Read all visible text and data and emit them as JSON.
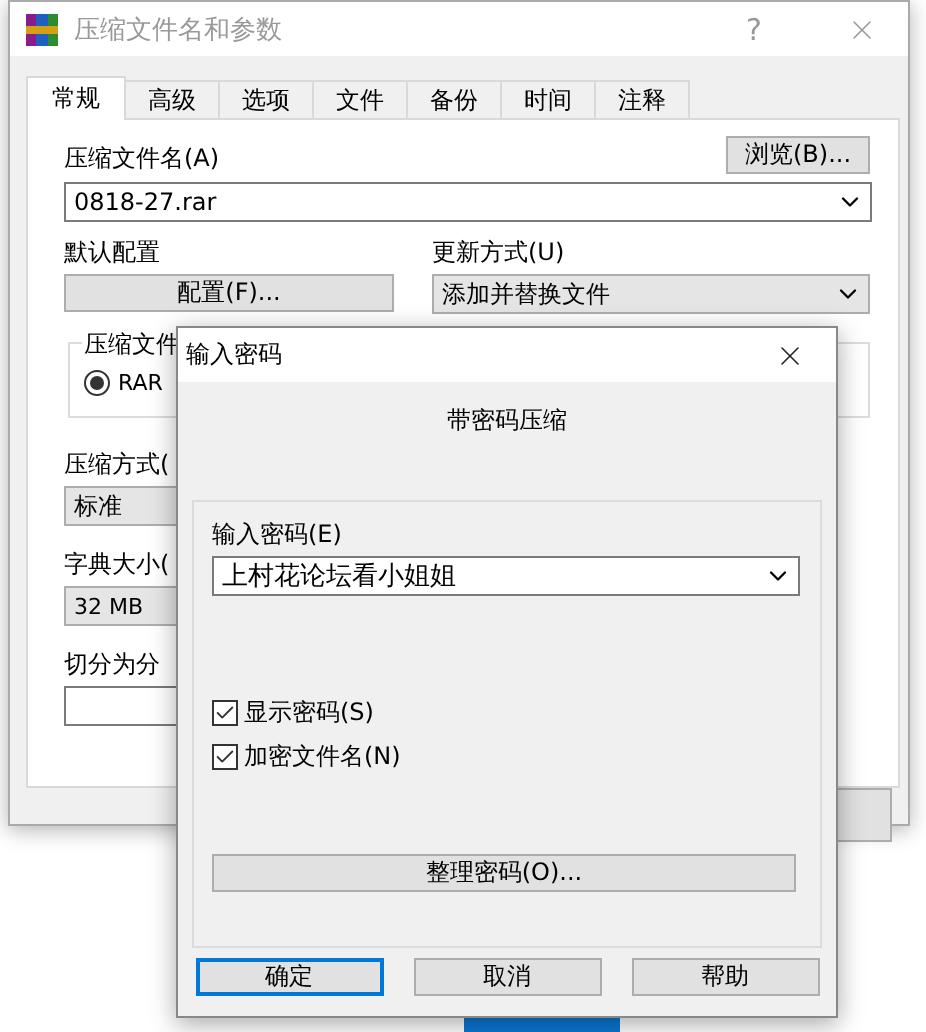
{
  "main_window": {
    "title": "压缩文件名和参数",
    "help": "?",
    "tabs": [
      {
        "label": "常规",
        "selected": true
      },
      {
        "label": "高级",
        "selected": false
      },
      {
        "label": "选项",
        "selected": false
      },
      {
        "label": "文件",
        "selected": false
      },
      {
        "label": "备份",
        "selected": false
      },
      {
        "label": "时间",
        "selected": false
      },
      {
        "label": "注释",
        "selected": false
      }
    ],
    "archive_name_label": "压缩文件名(A)",
    "browse_button": "浏览(B)...",
    "archive_name": "0818-27.rar",
    "profile_label": "默认配置",
    "profile_button": "配置(F)...",
    "update_label": "更新方式(U)",
    "update_mode": "添加并替换文件",
    "format_label": "压缩文件",
    "formats": [
      {
        "label": "RAR",
        "selected": true
      }
    ],
    "method_label": "压缩方式(",
    "method": "标准",
    "dict_label": "字典大小(",
    "dict": "32 MB",
    "split_label": "切分为分"
  },
  "password_dialog": {
    "title": "输入密码",
    "heading": "带密码压缩",
    "password_label": "输入密码(E)",
    "password": "上村花论坛看小姐姐",
    "options": [
      {
        "label": "显示密码(S)",
        "checked": true
      },
      {
        "label": "加密文件名(N)",
        "checked": true
      }
    ],
    "organize_button": "整理密码(O)...",
    "buttons": [
      {
        "label": "确定",
        "default": true
      },
      {
        "label": "取消",
        "default": false
      },
      {
        "label": "帮助",
        "default": false
      }
    ]
  }
}
